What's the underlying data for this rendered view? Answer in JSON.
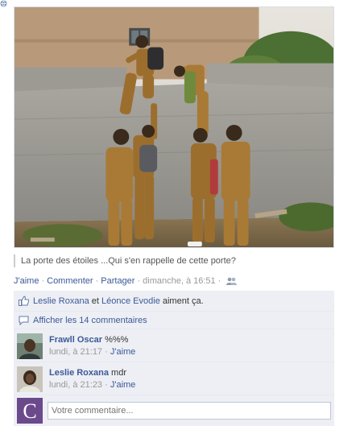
{
  "post": {
    "caption": "La porte des étoiles ...Qui s'en rappelle de cette porte?",
    "actions": {
      "like": "J'aime",
      "comment": "Commenter",
      "share": "Partager",
      "timestamp": "dimanche, à 16:51",
      "separator": "·"
    }
  },
  "likes": {
    "user1": "Leslie Roxana",
    "conjunction": "et",
    "user2": "Léonce Evodie",
    "suffix": "aiment ça."
  },
  "view_comments": "Afficher les 14 commentaires",
  "comments": [
    {
      "author": "Frawll Oscar",
      "text": "%%%",
      "time": "lundi, à 21:17",
      "like": "J'aime",
      "dot": "·"
    },
    {
      "author": "Leslie Roxana",
      "text": "mdr",
      "time": "lundi, à 21:23",
      "like": "J'aime",
      "dot": "·"
    }
  ],
  "compose": {
    "placeholder": "Votre commentaire...",
    "avatar_letter": "C"
  },
  "colors": {
    "link": "#3b5998",
    "ufi_bg": "#edeff4",
    "meta": "#999999",
    "avatar_purple": "#6b4a8c"
  },
  "icons": [
    "globe-icon",
    "people-icon",
    "thumbs-up-icon",
    "comment-bubble-icon"
  ]
}
